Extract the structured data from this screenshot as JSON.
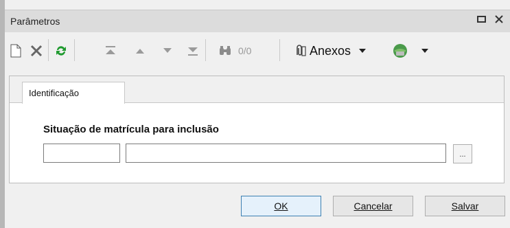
{
  "window": {
    "title": "Parâmetros"
  },
  "toolbar": {
    "counter": "0/0",
    "anexos_label": "Anexos"
  },
  "tabs": [
    {
      "label": "Identificação"
    }
  ],
  "form": {
    "field_label": "Situação de matrícula para inclusão",
    "code_value": "",
    "description_value": "",
    "lookup_label": "..."
  },
  "buttons": {
    "ok": "OK",
    "cancel": "Cancelar",
    "save": "Salvar"
  },
  "icons": {
    "new": "new-document-icon",
    "delete": "delete-x-icon",
    "refresh": "refresh-icon",
    "first": "first-record-icon",
    "prev": "previous-record-icon",
    "next": "next-record-icon",
    "last": "last-record-icon",
    "search": "binoculars-icon",
    "attach": "paperclip-icon",
    "globe": "globe-icon"
  },
  "colors": {
    "refresh_green": "#1f9a2f",
    "disabled_gray": "#9a9a9a",
    "primary_border": "#3c7fb1"
  }
}
